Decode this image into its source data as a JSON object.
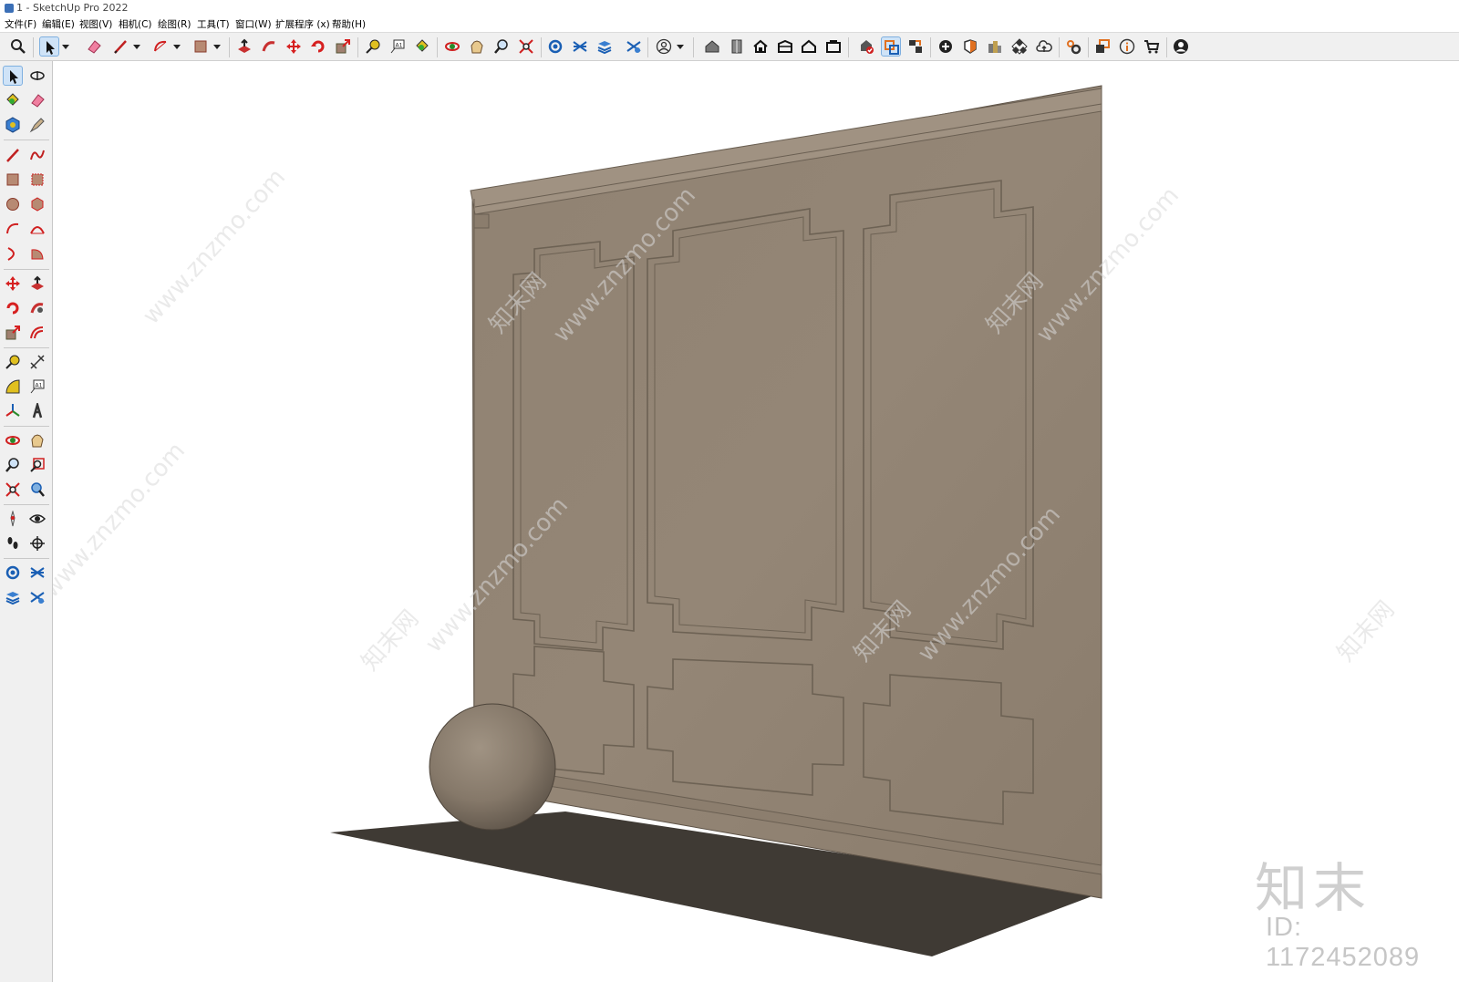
{
  "window": {
    "title": "1 - SketchUp Pro 2022"
  },
  "menu": [
    "文件(F)",
    "编辑(E)",
    "视图(V)",
    "相机(C)",
    "绘图(R)",
    "工具(T)",
    "窗口(W)",
    "扩展程序 (x)",
    "帮助(H)"
  ],
  "toolbar_icons": [
    "search-icon",
    "select-icon",
    "eraser-icon",
    "pencil-icon",
    "arc-icon",
    "rectangle-icon",
    "push-pull-icon",
    "follow-me-icon",
    "move-icon",
    "rotate-icon",
    "scale-icon",
    "tape-measure-icon",
    "text-icon",
    "paint-bucket-icon",
    "orbit-icon",
    "pan-icon",
    "zoom-icon",
    "zoom-extents-icon",
    "solid-tools-icon",
    "sandbox-icon",
    "layers-icon",
    "stamp-icon",
    "user-icon",
    "warehouse-icon",
    "component-icon",
    "house-icon",
    "shed-icon",
    "house-outline-icon",
    "box-icon",
    "check-icon",
    "section-plane-icon",
    "advanced-camera-icon",
    "add-location-icon",
    "shadow-icon",
    "styles-icon",
    "checkerboard-icon",
    "cloud-upload-icon",
    "extension-gear-icon",
    "scenes-icon",
    "info-icon",
    "cart-icon",
    "account-icon"
  ],
  "left_tool_icons": [
    "select-icon",
    "orbit-icon",
    "paint-bucket-icon",
    "eraser-icon",
    "component-icon",
    "tag-icon",
    "pencil-icon",
    "freehand-icon",
    "rectangle-icon",
    "rotated-rectangle-icon",
    "circle-icon",
    "polygon-icon",
    "arc-icon",
    "two-point-arc-icon",
    "three-point-arc-icon",
    "pie-icon",
    "move-icon",
    "push-pull-icon",
    "rotate-icon",
    "follow-me-icon",
    "scale-icon",
    "offset-icon",
    "tape-measure-icon",
    "dimension-icon",
    "protractor-icon",
    "text-icon",
    "axes-icon",
    "3d-text-icon",
    "orbit-icon",
    "pan-icon",
    "zoom-icon",
    "zoom-window-icon",
    "zoom-extents-icon",
    "previous-view-icon",
    "position-camera-icon",
    "look-around-icon",
    "walk-icon",
    "section-plane-icon",
    "solid-tools-icon",
    "sandbox-icon",
    "layers-icon",
    "stamp-icon"
  ],
  "watermark": {
    "site": "www.znzmo.com",
    "brand_cn": "知末网",
    "logo": "知末",
    "id_label": "ID: 1172452089"
  }
}
